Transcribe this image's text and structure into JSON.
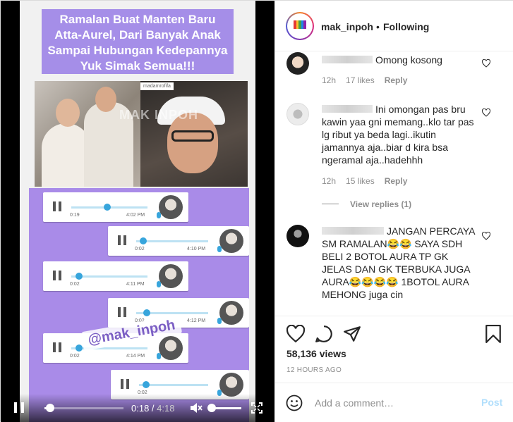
{
  "video": {
    "caption_lines": [
      "Ramalan Buat Manten Baru",
      "Atta-Aurel, Dari Banyak Anak",
      "Sampai Hubungan Kedepannya",
      "Yuk Simak Semua!!!"
    ],
    "photo_watermark": "MAK INPOH",
    "photo_tag": "madamrofifa",
    "handle_watermark": "@mak_inpoh",
    "voice_notes": [
      {
        "duration": "0:19",
        "time": "4:02 PM",
        "progress": 0.47
      },
      {
        "duration": "0:02",
        "time": "4:10 PM",
        "progress": 0.1
      },
      {
        "duration": "0:02",
        "time": "4:11 PM",
        "progress": 0.1
      },
      {
        "duration": "0:02",
        "time": "4:12 PM",
        "progress": 0.15
      },
      {
        "duration": "0:02",
        "time": "4:14 PM",
        "progress": 0.1
      },
      {
        "duration": "0:02",
        "time": "",
        "progress": 0.1
      }
    ],
    "player": {
      "current_time": "0:18",
      "separator": " / ",
      "total_time": "4:18",
      "progress": 0.07,
      "volume": 1.0
    }
  },
  "header": {
    "username": "mak_inpoh",
    "dot": "•",
    "follow_status": "Following"
  },
  "comments": [
    {
      "text": "Omong kosong",
      "age": "12h",
      "likes": "17 likes",
      "reply": "Reply"
    },
    {
      "text": "Ini omongan pas bru kawin yaa gni memang..klo tar pas lg ribut ya beda lagi..ikutin jamannya aja..biar d kira bsa ngeramal aja..hadehhh",
      "age": "12h",
      "likes": "15 likes",
      "reply": "Reply",
      "view_replies": "View replies (1)"
    },
    {
      "text": "JANGAN PERCAYA SM RAMALAN😂😂 SAYA SDH BELI 2 BOTOL AURA TP GK JELAS DAN GK TERBUKA JUGA AURA😂😂😂😂 1BOTOL AURA MEHONG juga cin"
    }
  ],
  "post": {
    "views": "58,136 views",
    "timestamp": "12 HOURS AGO"
  },
  "add_comment": {
    "placeholder": "Add a comment…",
    "post_label": "Post"
  },
  "colors": {
    "caption_bg": "#a58ee8",
    "chat_bg": "#a98be8",
    "post_button": "#b2dffc",
    "muted_text": "#8e8e8e"
  },
  "icons": [
    "pause-icon",
    "mute-icon",
    "fullscreen-icon",
    "heart-icon",
    "comment-icon",
    "share-icon",
    "bookmark-icon",
    "emoji-icon",
    "more-icon"
  ]
}
